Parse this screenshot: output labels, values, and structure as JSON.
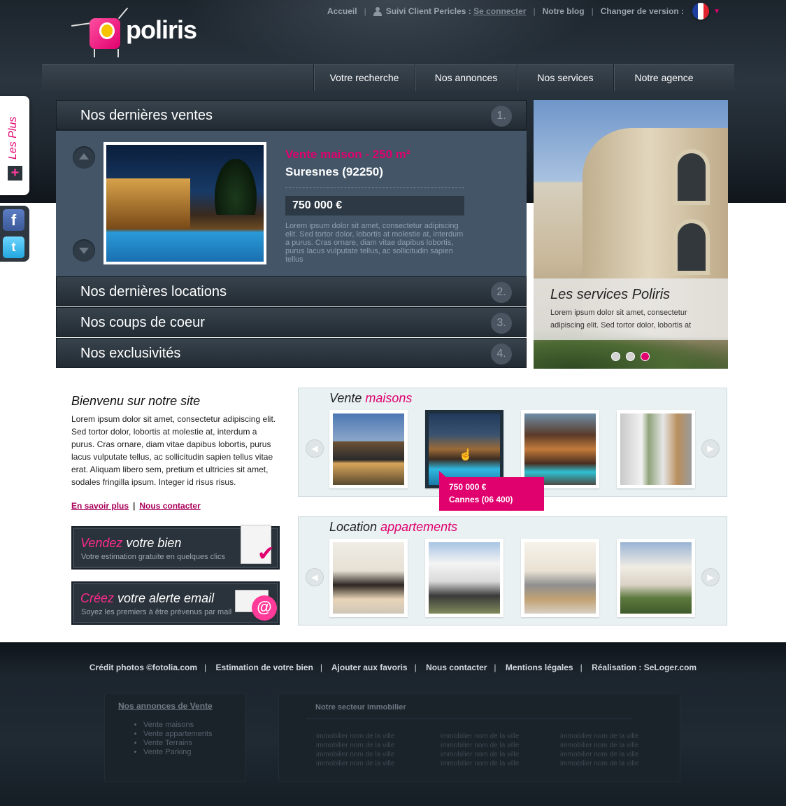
{
  "brand": {
    "name": "poliris"
  },
  "topbar": {
    "home": "Accueil",
    "client_label": "Suivi Client Pericles :",
    "client_login": "Se connecter",
    "blog": "Notre blog",
    "version_label": "Changer de version :"
  },
  "nav": [
    "Votre recherche",
    "Nos annonces",
    "Nos services",
    "Notre agence"
  ],
  "side": {
    "les_plus": "Les Plus",
    "plus": "+",
    "facebook": "f",
    "twitter": "t"
  },
  "accordion": [
    {
      "title": "Nos dernières ventes",
      "num": "1."
    },
    {
      "title": "Nos dernières locations",
      "num": "2."
    },
    {
      "title": "Nos coups de coeur",
      "num": "3."
    },
    {
      "title": "Nos exclusivités",
      "num": "4."
    }
  ],
  "featured": {
    "title": "Vente maison - 250 m²",
    "city": "Suresnes (92250)",
    "price": "750 000 €",
    "desc": "Lorem ipsum dolor sit amet, consectetur adipiscing elit. Sed tortor dolor, lobortis at molestie at, interdum a purus. Cras ornare, diam vitae dapibus lobortis, purus lacus vulputate tellus, ac sollicitudin sapien tellus"
  },
  "services": {
    "title": "Les services Poliris",
    "text": "Lorem ipsum dolor sit amet, consectetur adipiscing elit. Sed tortor dolor, lobortis at",
    "slides": 3,
    "active_slide": 3
  },
  "welcome": {
    "title": "Bienvenu sur notre site",
    "text": "Lorem ipsum dolor sit amet, consectetur adipiscing elit. Sed tortor dolor, lobortis at molestie at, interdum a purus. Cras ornare, diam vitae dapibus lobortis, purus lacus vulputate tellus, ac sollicitudin sapien tellus vitae erat. Aliquam libero sem, pretium et ultricies sit amet, sodales fringilla ipsum. Integer id risus risus.",
    "link_more": "En savoir plus",
    "link_sep": "|",
    "link_contact": "Nous contacter"
  },
  "cta": [
    {
      "accent": "Vendez",
      "rest": " votre bien",
      "sub": "Votre estimation gratuite en quelques clics",
      "icon": "document-check-icon"
    },
    {
      "accent": "Créez",
      "rest": " votre alerte email",
      "sub": "Soyez les premiers à être prévenus par mail",
      "icon": "email-alert-icon"
    }
  ],
  "gallery_sale": {
    "title": "Vente ",
    "accent": "maisons",
    "tooltip_price": "750 000 €",
    "tooltip_city": "Cannes (06 400)",
    "selected": 2
  },
  "gallery_rent": {
    "title": "Location ",
    "accent": "appartements"
  },
  "footer": {
    "links": [
      "Crédit photos ©fotolia.com",
      "Estimation de votre bien",
      "Ajouter aux favoris",
      "Nous contacter",
      "Mentions légales",
      "Réalisation : SeLoger.com"
    ],
    "sale_title": "Nos annonces de Vente",
    "sale_items": [
      "Vente maisons",
      "Vente appartements",
      "Vente Terrains",
      "Vente Parking"
    ],
    "sector_title": "Notre secteur immobilier",
    "sector_item": "immobilier nom de la ville"
  },
  "colors": {
    "accent": "#e0006e",
    "dark": "#2a353f",
    "panel": "#435567"
  }
}
